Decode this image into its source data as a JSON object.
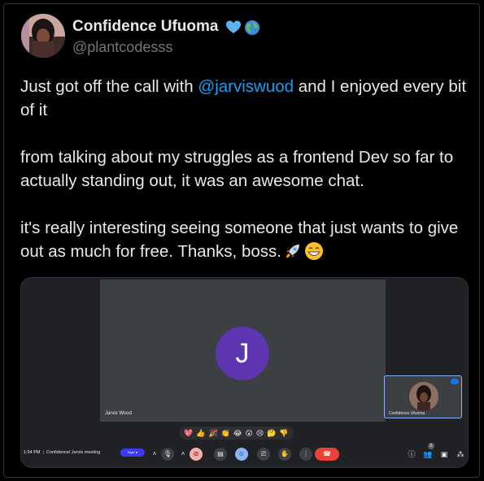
{
  "author": {
    "display_name": "Confidence Ufuoma",
    "handle": "@plantcodesss",
    "badges": [
      "blue-heart-icon",
      "globe-icon"
    ]
  },
  "tweet": {
    "line1_before": "Just got off the call with ",
    "mention": "@jarviswuod",
    "line1_after": " and I enjoyed every bit of it",
    "para2": "from talking about my struggles as a frontend Dev so far to actually standing out, it was an awesome chat.",
    "para3": "it's really interesting seeing someone that just wants to give out as much for free. Thanks, boss.",
    "para3_emojis": [
      "rocket-emoji",
      "grinning-emoji"
    ]
  },
  "media": {
    "main_participant_initial": "J",
    "main_participant_name": "Jarvis Wuod",
    "self_name": "Confidence Ufuoma",
    "meeting_time": "1:54 PM",
    "meeting_title": "Confidence/ Jarvis meeting",
    "caption_pill": "Style ●",
    "participant_count": "2",
    "reactions": [
      "💖",
      "👍",
      "🎉",
      "👏",
      "😂",
      "😮",
      "😢",
      "🤔",
      "👎"
    ],
    "colors": {
      "avatar": "#5e35b1",
      "hangup": "#ea4335",
      "self_border": "#8ab4f8"
    }
  },
  "controls": {
    "mic_icon": "🎙",
    "cam_icon": "⊘",
    "caption_icon": "▤",
    "emoji_icon": "☺",
    "present_icon": "⎚",
    "hand_icon": "✋",
    "more_icon": "⋮",
    "hangup_icon": "☎",
    "info_icon": "ⓘ",
    "people_icon": "👥",
    "chat_icon": "▣",
    "activities_icon": "⁂"
  }
}
